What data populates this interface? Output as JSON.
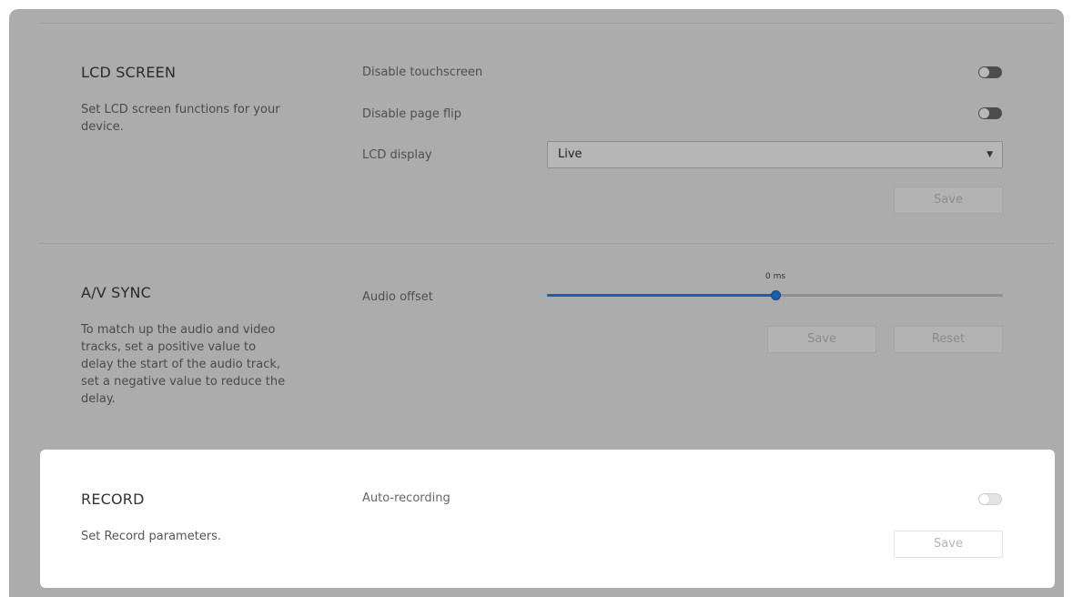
{
  "lcd": {
    "title": "LCD SCREEN",
    "description": "Set LCD screen functions for your device.",
    "disable_touchscreen_label": "Disable touchscreen",
    "disable_touchscreen_on": false,
    "disable_page_flip_label": "Disable page flip",
    "disable_page_flip_on": false,
    "lcd_display_label": "LCD display",
    "lcd_display_value": "Live",
    "save_label": "Save"
  },
  "av_sync": {
    "title": "A/V SYNC",
    "description": "To match up the audio and video tracks, set a positive value to delay the start of the audio track, set a negative value to reduce the delay.",
    "audio_offset_label": "Audio offset",
    "audio_offset_value_text": "0 ms",
    "audio_offset_fraction": 0.5,
    "save_label": "Save",
    "reset_label": "Reset"
  },
  "record": {
    "title": "RECORD",
    "description": "Set Record parameters.",
    "auto_recording_label": "Auto-recording",
    "auto_recording_on": false,
    "save_label": "Save"
  },
  "colors": {
    "overlay": "#acacac",
    "accent": "#1a5fa8",
    "card": "#ffffff"
  }
}
